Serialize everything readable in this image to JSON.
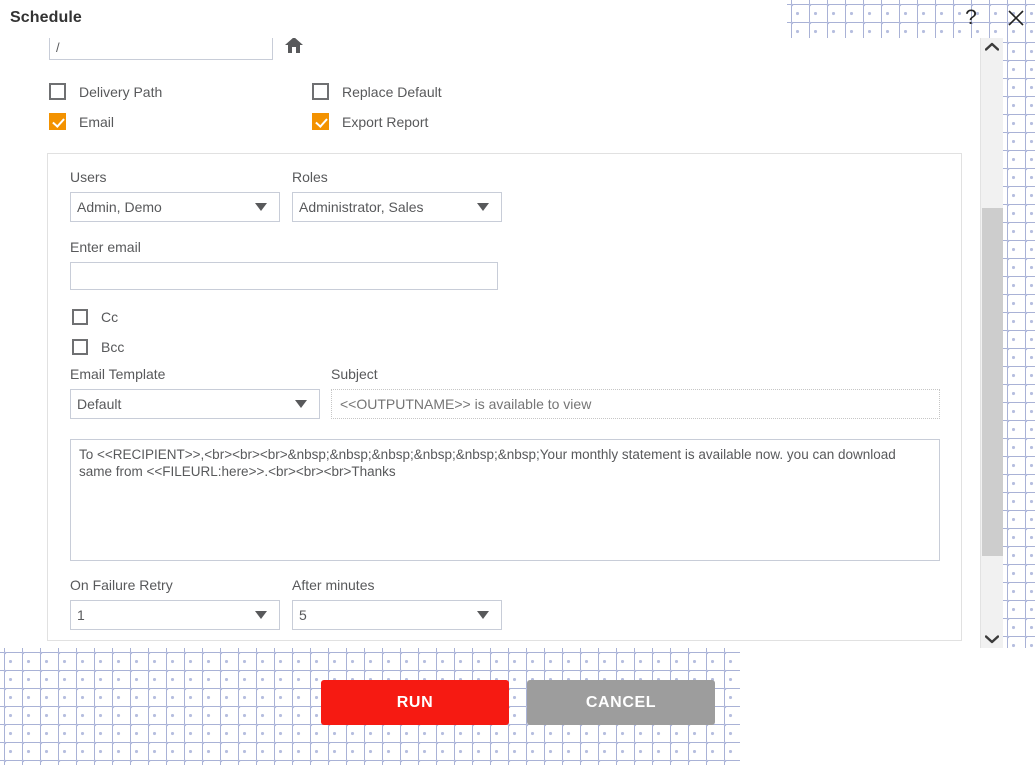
{
  "dialog": {
    "title": "Schedule",
    "help_icon": "question-mark-icon",
    "close_icon": "close-icon"
  },
  "form": {
    "path": {
      "value": "/",
      "placeholder": "",
      "home_icon": "home-icon"
    },
    "options": [
      {
        "label": "Delivery Path",
        "checked": false
      },
      {
        "label": "Email",
        "checked": true
      },
      {
        "label": "Replace Default",
        "checked": false
      },
      {
        "label": "Export Report",
        "checked": true
      }
    ],
    "email_panel": {
      "users": {
        "label": "Users",
        "value": "Admin, Demo"
      },
      "roles": {
        "label": "Roles",
        "value": "Administrator, Sales"
      },
      "enter_email": {
        "label": "Enter email",
        "value": "",
        "placeholder": ""
      },
      "cc": {
        "label": "Cc",
        "checked": false
      },
      "bcc": {
        "label": "Bcc",
        "checked": false
      },
      "template": {
        "label": "Email Template",
        "value": "Default"
      },
      "subject": {
        "label": "Subject",
        "value": "",
        "placeholder": "<<OUTPUTNAME>> is available to view"
      },
      "body": {
        "value": "To <<RECIPIENT>>,<br><br><br>&nbsp;&nbsp;&nbsp;&nbsp;&nbsp;&nbsp;Your monthly statement is available now. you can download same from <<FILEURL:here>>.<br><br><br>Thanks"
      },
      "on_failure_retry": {
        "label": "On Failure Retry",
        "value": "1"
      },
      "after_minutes": {
        "label": "After minutes",
        "value": "5"
      }
    }
  },
  "footer": {
    "run_label": "RUN",
    "cancel_label": "CANCEL"
  },
  "colors": {
    "accent_orange": "#f39200",
    "run_red": "#f61a12",
    "cancel_gray": "#9d9d9d",
    "text": "#58595b",
    "dot_pattern": "#b3bbdd"
  }
}
